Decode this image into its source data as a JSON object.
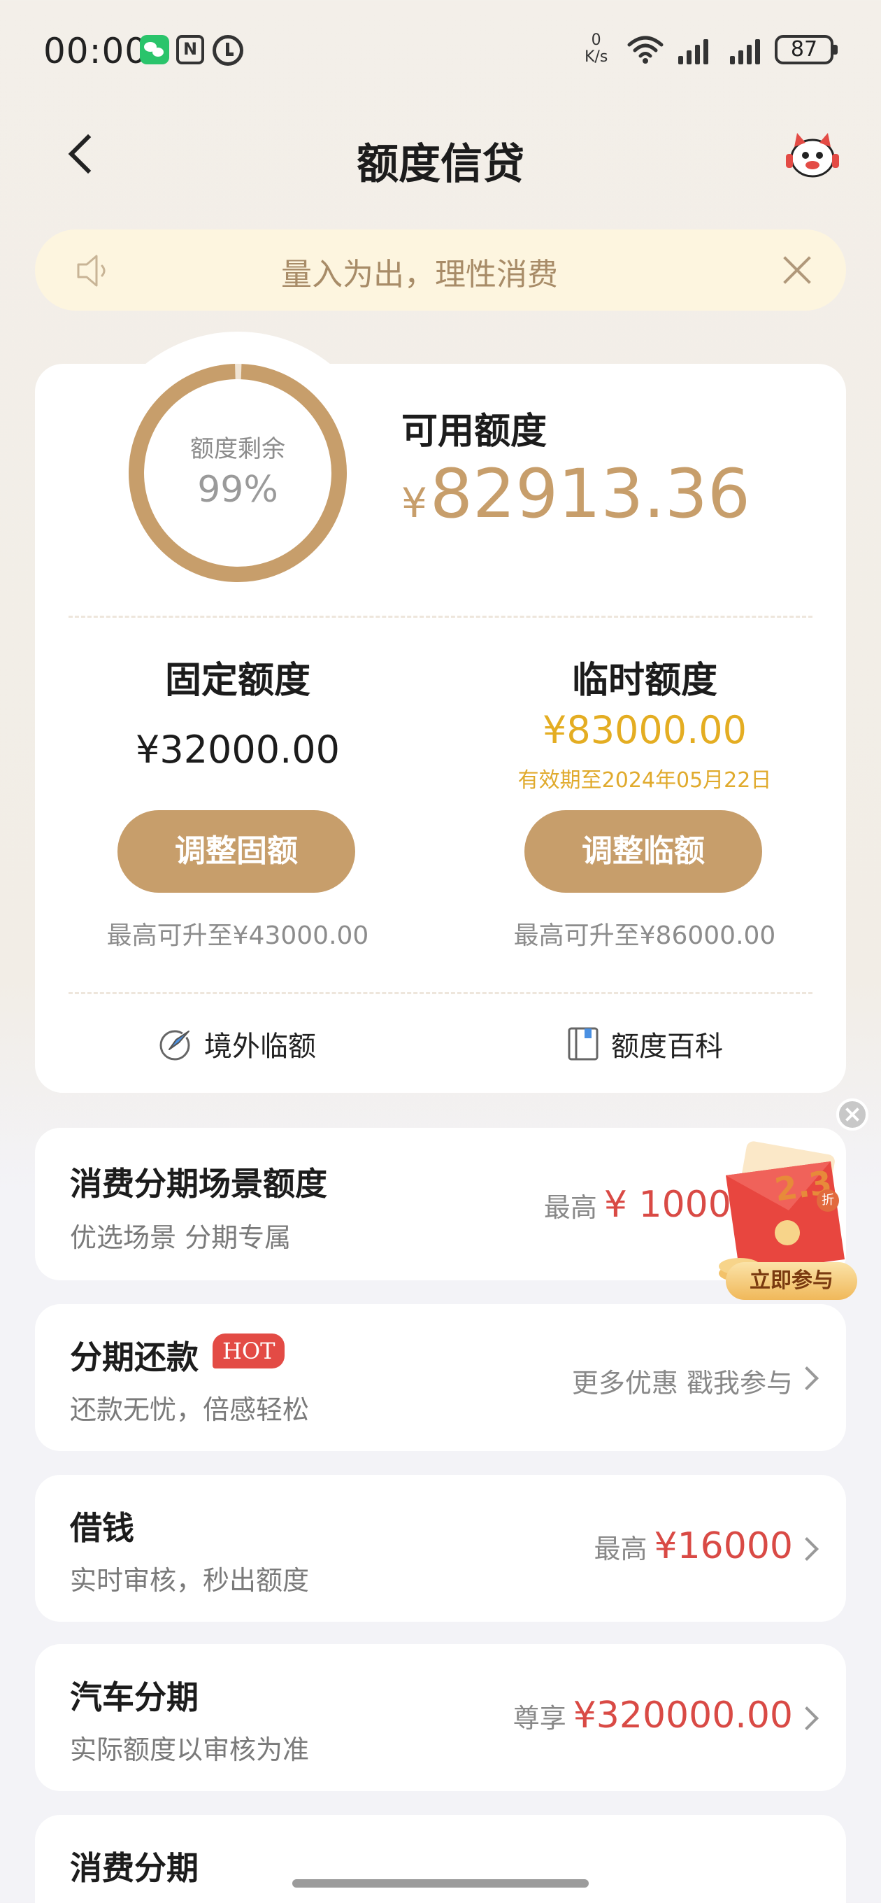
{
  "status_bar": {
    "time": "00:00",
    "net_speed_value": "0",
    "net_speed_unit": "K/s",
    "battery": "87",
    "icons": [
      "wechat-icon",
      "nfc-icon",
      "alarm-icon",
      "wifi-icon",
      "signal-icon",
      "signal-icon",
      "battery-icon"
    ]
  },
  "header": {
    "title": "额度信贷",
    "back_icon": "chevron-left-icon",
    "assistant_icon": "mascot-icon"
  },
  "notice": {
    "text": "量入为出，理性消费",
    "icon": "speaker-icon",
    "close_icon": "close-icon"
  },
  "credit": {
    "ring_label": "额度剩余",
    "ring_percent_text": "99%",
    "ring_fraction": 0.99,
    "available_label": "可用额度",
    "available_currency": "¥",
    "available_amount": "82913.36",
    "fixed": {
      "title": "固定额度",
      "amount": "¥32000.00",
      "button": "调整固额",
      "max_raise": "最高可升至¥43000.00"
    },
    "temporary": {
      "title": "临时额度",
      "amount": "¥83000.00",
      "expiry": "有效期至2024年05月22日",
      "button": "调整临额",
      "max_raise": "最高可升至¥86000.00"
    },
    "links": [
      {
        "label": "境外临额",
        "icon": "plane-globe-icon"
      },
      {
        "label": "额度百科",
        "icon": "book-icon"
      }
    ]
  },
  "services": [
    {
      "title": "消费分期场景额度",
      "subtitle": "优选场景 分期专属",
      "right_prefix": "最高",
      "right_value": "¥ 100000"
    },
    {
      "title": "分期还款",
      "badge": "HOT",
      "subtitle": "还款无忧，倍感轻松",
      "right_prefix": "更多优惠 戳我参与",
      "right_value": ""
    },
    {
      "title": "借钱",
      "subtitle": "实时审核，秒出额度",
      "right_prefix": "最高",
      "right_value": "¥16000"
    },
    {
      "title": "汽车分期",
      "subtitle": "实际额度以审核为准",
      "right_prefix": "尊享",
      "right_value": "¥320000.00"
    },
    {
      "title": "消费分期",
      "subtitle": "",
      "right_prefix": "",
      "right_value": ""
    }
  ],
  "promo": {
    "discount": "2.3",
    "discount_unit": "折",
    "button": "立即参与",
    "close_icon": "close-icon"
  },
  "colors": {
    "accent_gold": "#c79e6b",
    "temp_yellow": "#e4ad22",
    "price_red": "#d94a45",
    "notice_bg": "#fdf5df"
  }
}
